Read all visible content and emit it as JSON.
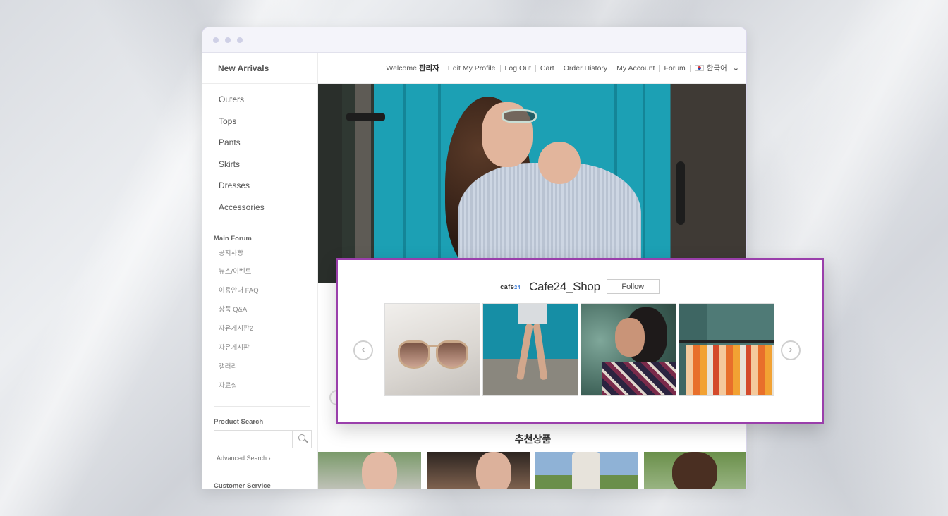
{
  "sidebar": {
    "brand": "New Arrivals",
    "categories": [
      "Outers",
      "Tops",
      "Pants",
      "Skirts",
      "Dresses",
      "Accessories"
    ],
    "forum_title": "Main Forum",
    "forum_items": [
      "공지사항",
      "뉴스/이벤트",
      "이용안내 FAQ",
      "상품 Q&A",
      "자유게시판2",
      "자유게시판",
      "갤러리",
      "자료실"
    ],
    "product_search_title": "Product Search",
    "advanced_search": "Advanced Search ›",
    "customer_service": "Customer Service"
  },
  "topbar": {
    "welcome": "Welcome",
    "user": "관리자",
    "edit_profile": "Edit My Profile",
    "logout": "Log Out",
    "cart": "Cart",
    "order_history": "Order History",
    "my_account": "My Account",
    "forum": "Forum",
    "language": "한국어",
    "chevron": "⌄"
  },
  "widget": {
    "logo_main": "cafe",
    "logo_num": "24",
    "shop_name": "Cafe24_Shop",
    "follow_label": "Follow",
    "prev_glyph": "‹",
    "next_glyph": "›"
  },
  "main": {
    "section_title": "추천상품"
  },
  "colors": {
    "widget_border": "#9a3fab",
    "hero_door": "#1ca0b4"
  }
}
